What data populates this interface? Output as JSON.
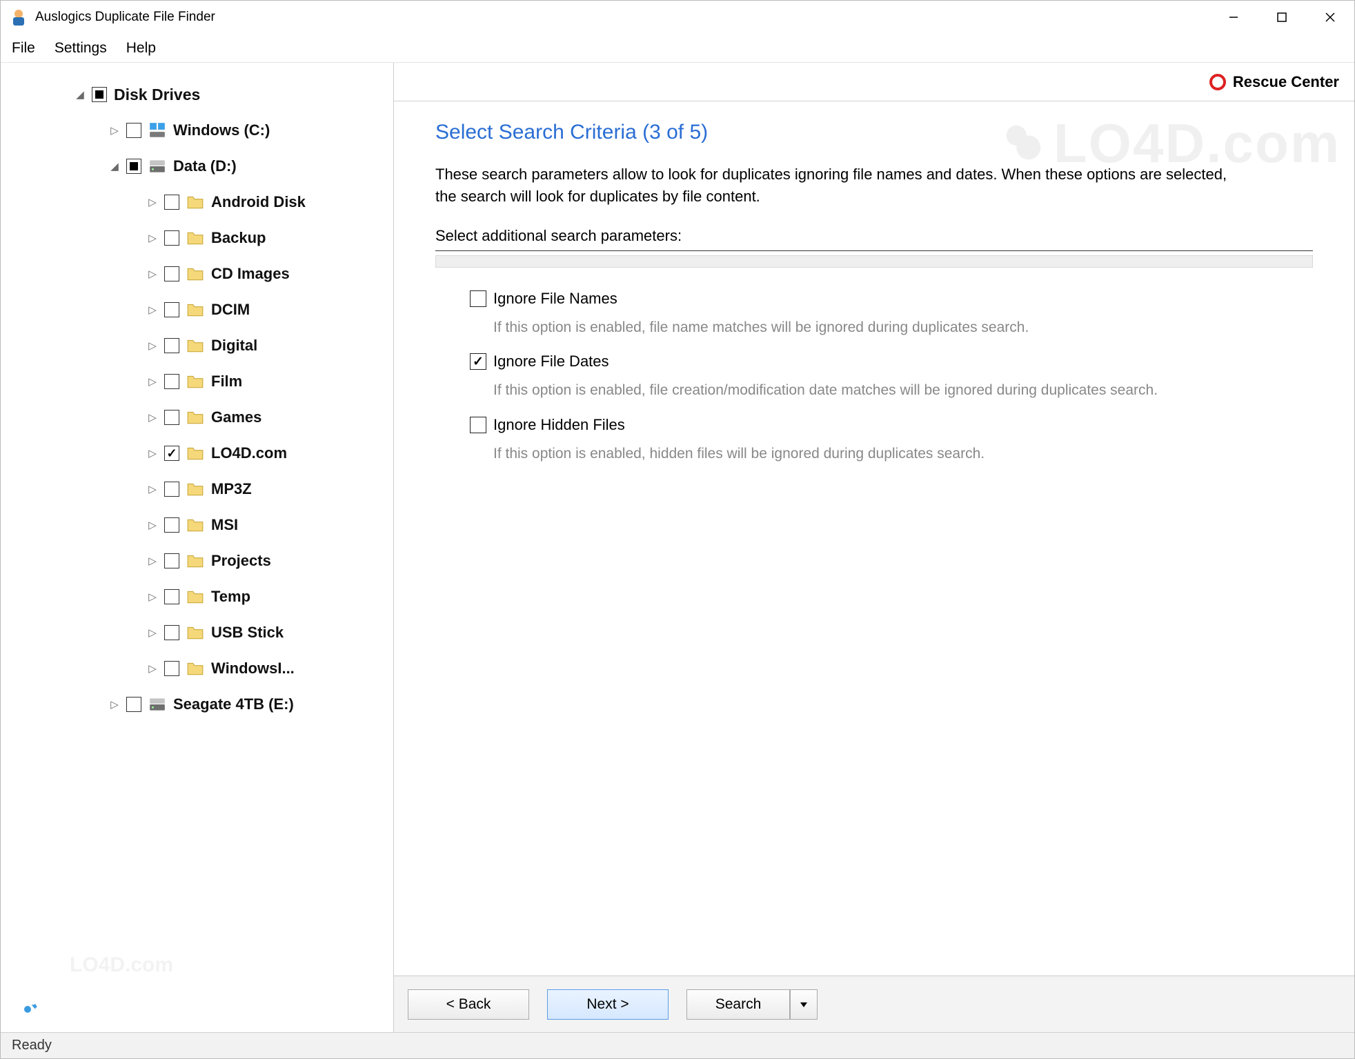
{
  "window": {
    "title": "Auslogics Duplicate File Finder"
  },
  "menu": {
    "file": "File",
    "settings": "Settings",
    "help": "Help"
  },
  "rescue": "Rescue Center",
  "tree": {
    "root_label": "Disk Drives",
    "drives": [
      {
        "label": "Windows (C:)",
        "expanded": false,
        "check": "unchecked",
        "type": "drive-win"
      },
      {
        "label": "Data (D:)",
        "expanded": true,
        "check": "mixed",
        "type": "drive",
        "children": [
          {
            "label": "Android Disk",
            "check": "unchecked"
          },
          {
            "label": "Backup",
            "check": "unchecked"
          },
          {
            "label": "CD Images",
            "check": "unchecked"
          },
          {
            "label": "DCIM",
            "check": "unchecked"
          },
          {
            "label": "Digital",
            "check": "unchecked"
          },
          {
            "label": "Film",
            "check": "unchecked"
          },
          {
            "label": "Games",
            "check": "unchecked"
          },
          {
            "label": "LO4D.com",
            "check": "checked"
          },
          {
            "label": "MP3Z",
            "check": "unchecked"
          },
          {
            "label": "MSI",
            "check": "unchecked"
          },
          {
            "label": "Projects",
            "check": "unchecked"
          },
          {
            "label": "Temp",
            "check": "unchecked"
          },
          {
            "label": "USB Stick",
            "check": "unchecked"
          },
          {
            "label": "WindowsI...",
            "check": "unchecked"
          }
        ]
      },
      {
        "label": "Seagate 4TB (E:)",
        "expanded": false,
        "check": "unchecked",
        "type": "drive"
      }
    ]
  },
  "page": {
    "title": "Select Search Criteria (3 of 5)",
    "description": "These search parameters allow to look for duplicates ignoring file names and dates. When these options are selected, the search will look for duplicates by file content.",
    "sub_label": "Select additional search parameters:",
    "options": [
      {
        "label": "Ignore File Names",
        "checked": false,
        "desc": "If this option is enabled, file name matches will be ignored during duplicates search."
      },
      {
        "label": "Ignore File Dates",
        "checked": true,
        "desc": "If this option is enabled, file creation/modification date matches will be ignored during duplicates search."
      },
      {
        "label": "Ignore Hidden Files",
        "checked": false,
        "desc": "If this option is enabled, hidden files will be ignored during duplicates search."
      }
    ]
  },
  "buttons": {
    "back": "< Back",
    "next": "Next >",
    "search": "Search"
  },
  "status": "Ready"
}
